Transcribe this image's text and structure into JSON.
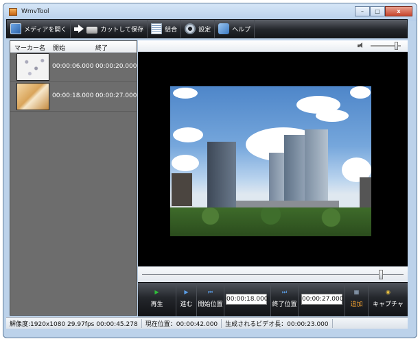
{
  "window": {
    "title": "WmvTool"
  },
  "window_controls": {
    "minimize": "–",
    "maximize": "□",
    "close": "x"
  },
  "toolbar": {
    "open_label": "メディアを開く",
    "cut_save_label": "カットして保存",
    "join_label": "結合",
    "settings_label": "設定",
    "help_label": "ヘルプ"
  },
  "marker_list": {
    "columns": [
      "マーカー名",
      "開始",
      "終了"
    ],
    "rows": [
      {
        "start": "00:00:06.000",
        "end": "00:00:20.000"
      },
      {
        "start": "00:00:18.000",
        "end": "00:00:27.000"
      }
    ]
  },
  "volume": {
    "level": 0.9
  },
  "seek": {
    "position": 0.92
  },
  "controls": {
    "play_label": "再生",
    "step_label": "進む",
    "start_pos_label": "開始位置",
    "start_time": "00:00:18.000",
    "end_pos_label": "終了位置",
    "end_time": "00:00:27.000",
    "add_label": "追加",
    "capture_label": "キャプチャ"
  },
  "status": {
    "resolution": "解像度:1920x1080 29.97fps 00:00:45.278",
    "current_position": "現在位置：00:00:42.000",
    "output_length": "生成されるビデオ長：00:00:23.000"
  },
  "colors": {
    "add_accent": "#f0a030",
    "play_icon": "#2fbf3a",
    "nav_icon": "#5a9de6"
  }
}
